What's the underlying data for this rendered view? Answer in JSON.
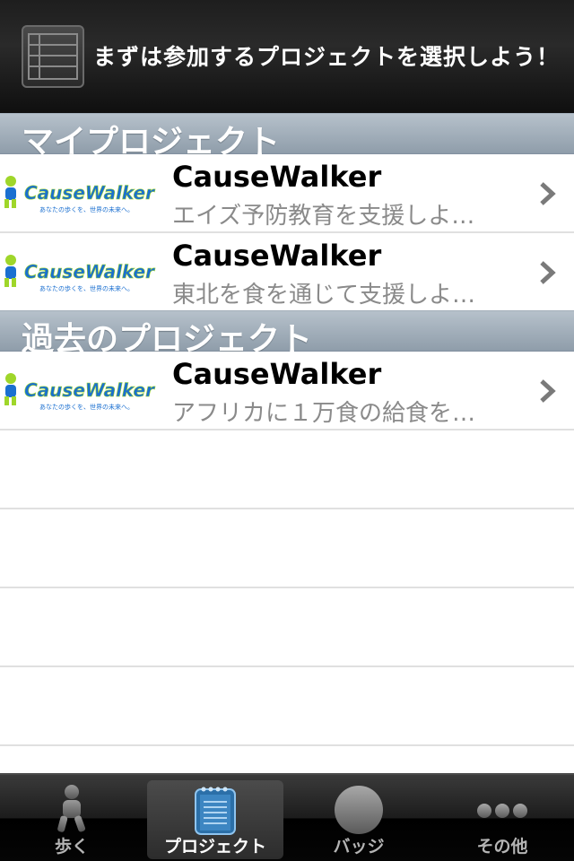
{
  "header": {
    "title": "まずは参加するプロジェクトを選択しよう！",
    "menu_icon": "list-table-icon"
  },
  "sections": [
    {
      "label": "マイプロジェクト",
      "rows": [
        {
          "title": "CauseWalker",
          "subtitle": "エイズ予防教育を支援しよ…",
          "logo_text": "CauseWalker",
          "logo_tagline": "あなたの歩くを、世界の未来へ。"
        },
        {
          "title": "CauseWalker",
          "subtitle": "東北を食を通じて支援しよ…",
          "logo_text": "CauseWalker",
          "logo_tagline": "あなたの歩くを、世界の未来へ。"
        }
      ]
    },
    {
      "label": "過去のプロジェクト",
      "rows": [
        {
          "title": "CauseWalker",
          "subtitle": "アフリカに１万食の給食を…",
          "logo_text": "CauseWalker",
          "logo_tagline": "あなたの歩くを、世界の未来へ。"
        }
      ]
    }
  ],
  "tabbar": {
    "tabs": [
      {
        "label": "歩く",
        "icon": "walking-person-icon",
        "selected": false
      },
      {
        "label": "プロジェクト",
        "icon": "notepad-icon",
        "selected": true
      },
      {
        "label": "バッジ",
        "icon": "badge-circle-icon",
        "selected": false
      },
      {
        "label": "その他",
        "icon": "more-dots-icon",
        "selected": false
      }
    ]
  },
  "colors": {
    "header_bg": "#1e1e1e",
    "section_bg": "#9aa7b4",
    "subtitle": "#8a8a8a",
    "logo_blue": "#1a6fd0",
    "logo_green": "#9fd62a"
  }
}
